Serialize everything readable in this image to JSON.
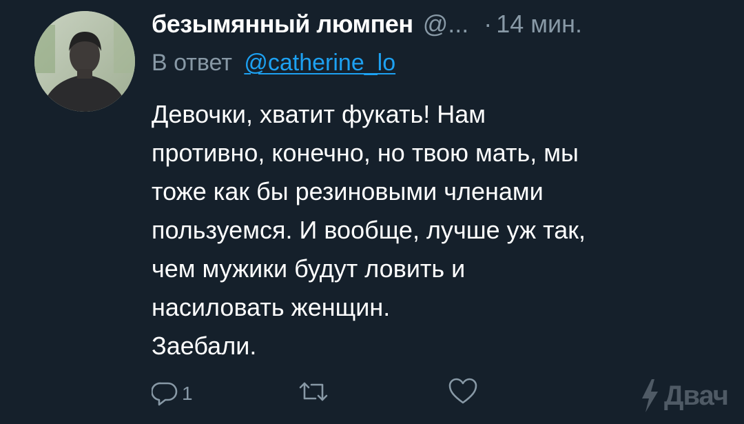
{
  "tweet": {
    "author_name": "безымянный люмпен",
    "author_handle": "@...",
    "separator": "·",
    "timestamp": "14 мин.",
    "reply_prefix": "В ответ",
    "reply_to": "@catherine_lo",
    "text_lines": [
      "Девочки, хватит фукать! Нам",
      "противно, конечно, но твою мать, мы",
      "тоже как бы резиновыми членами",
      "пользуемся. И вообще, лучше уж так,",
      "чем мужики будут ловить и",
      "насиловать женщин.",
      "Заебали."
    ]
  },
  "actions": {
    "reply": {
      "icon": "reply-icon",
      "count": "1"
    },
    "retweet": {
      "icon": "retweet-icon"
    },
    "like": {
      "icon": "heart-icon"
    }
  },
  "watermark": {
    "icon": "lightning-icon",
    "text": "Двач"
  },
  "colors": {
    "background": "#15202b",
    "text_primary": "#ffffff",
    "text_secondary": "#8899a6",
    "link": "#1da1f2"
  }
}
